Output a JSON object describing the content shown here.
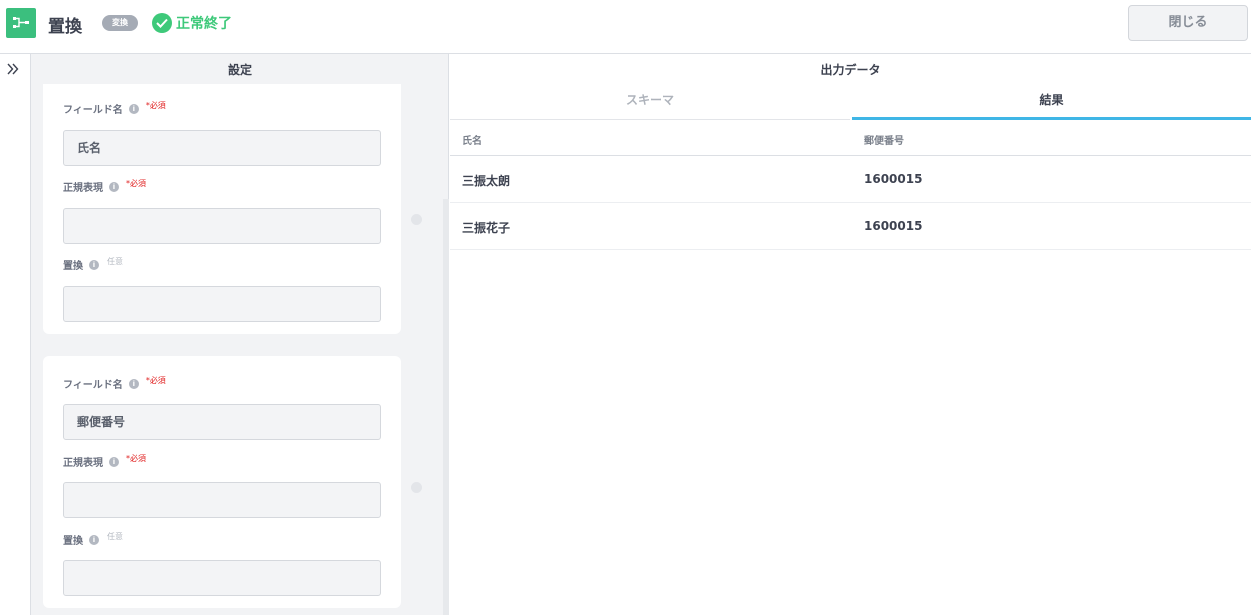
{
  "header": {
    "title": "置換",
    "badge": "変換",
    "status": "正常終了",
    "close_label": "閉じる"
  },
  "settings": {
    "title": "設定",
    "cards": [
      {
        "field_name_label": "フィールド名",
        "field_name_required": "*必須",
        "field_name_value": "氏名",
        "regex_label": "正規表現",
        "regex_required": "*必須",
        "regex_value": "",
        "replace_label": "置換",
        "replace_optional": "任意",
        "replace_value": ""
      },
      {
        "field_name_label": "フィールド名",
        "field_name_required": "*必須",
        "field_name_value": "郵便番号",
        "regex_label": "正規表現",
        "regex_required": "*必須",
        "regex_value": "",
        "replace_label": "置換",
        "replace_optional": "任意",
        "replace_value": ""
      }
    ]
  },
  "output": {
    "title": "出力データ",
    "tabs": [
      "スキーマ",
      "結果"
    ],
    "active_tab": "結果",
    "columns": [
      "氏名",
      "郵便番号"
    ],
    "rows": [
      [
        "三振太朗",
        "1600015"
      ],
      [
        "三振花子",
        "1600015"
      ]
    ]
  },
  "colors": {
    "brand": "#3bbf7e",
    "success": "#3ec97a",
    "active_tab": "#3fb6e6",
    "required": "#e02020"
  },
  "icons": {
    "logo": "flow-icon",
    "status": "check-circle-icon",
    "info": "info-icon",
    "rail": "double-chevron-right-icon"
  }
}
